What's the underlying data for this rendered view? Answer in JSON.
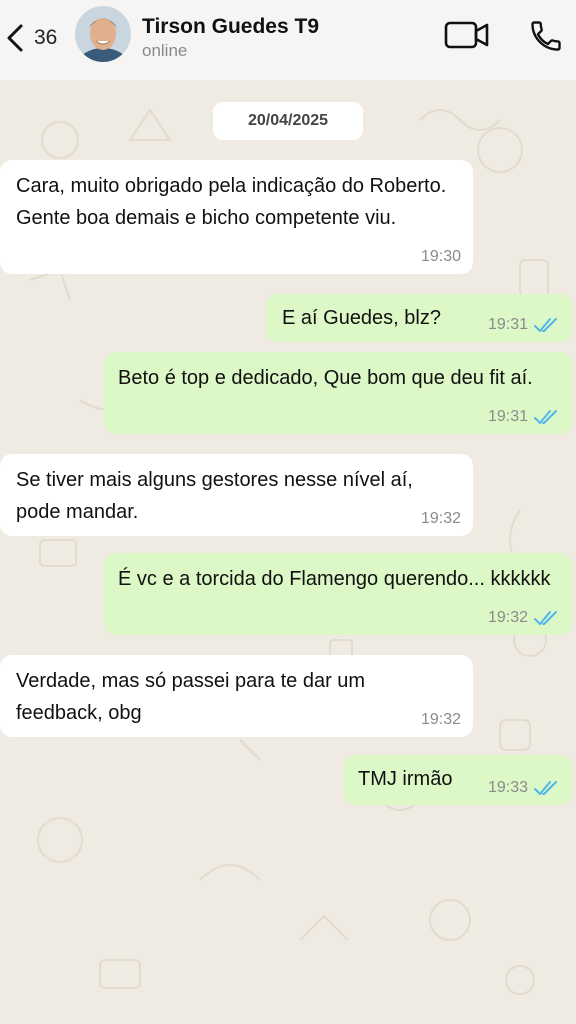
{
  "header": {
    "back_count": "36",
    "contact_name": "Tirson Guedes T9",
    "contact_status": "online"
  },
  "icons": {
    "back": "chevron-left-icon",
    "video": "video-camera-icon",
    "call": "phone-icon",
    "read": "double-check-icon"
  },
  "colors": {
    "background": "#efeae2",
    "incoming": "#ffffff",
    "outgoing": "#dcf8c6",
    "tick": "#4fb6ec"
  },
  "chat": {
    "date": "20/04/2025",
    "messages": [
      {
        "dir": "in",
        "text": "Cara, muito obrigado pela indicação do Roberto. Gente boa demais e bicho competente viu.",
        "time": "19:30"
      },
      {
        "dir": "out",
        "text": "E aí Guedes, blz?",
        "time": "19:31",
        "read": true
      },
      {
        "dir": "out",
        "text": "Beto é top e dedicado, Que bom que deu fit aí.",
        "time": "19:31",
        "read": true
      },
      {
        "dir": "in",
        "text": "Se tiver mais alguns gestores nesse nível aí, pode mandar.",
        "time": "19:32"
      },
      {
        "dir": "out",
        "text": "É vc e a torcida do Flamengo querendo... kkkkkk",
        "time": "19:32",
        "read": true
      },
      {
        "dir": "in",
        "text": "Verdade, mas só passei para te dar um feedback, obg",
        "time": "19:32"
      },
      {
        "dir": "out",
        "text": "TMJ irmão",
        "time": "19:33",
        "read": true
      }
    ]
  }
}
